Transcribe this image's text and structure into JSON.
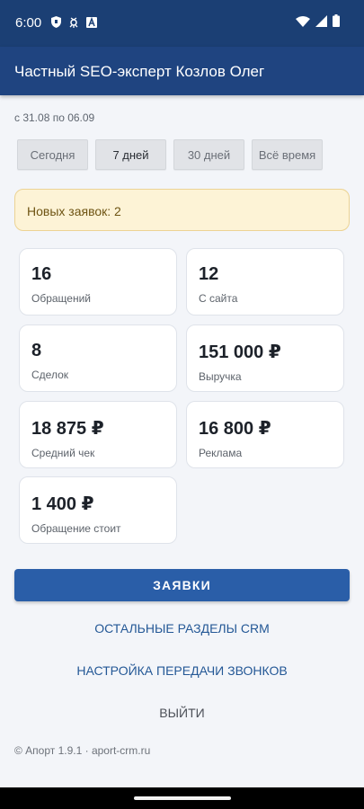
{
  "status_bar": {
    "time": "6:00",
    "icons_left": [
      "shield-icon",
      "bug-icon",
      "font-icon"
    ],
    "icons_right": [
      "wifi-icon",
      "signal-icon",
      "battery-icon"
    ]
  },
  "header": {
    "title": "Частный SEO-эксперт Козлов Олег"
  },
  "period": "с 31.08 по 06.09",
  "filters": [
    {
      "label": "Сегодня",
      "active": false
    },
    {
      "label": "7 дней",
      "active": true
    },
    {
      "label": "30 дней",
      "active": false
    },
    {
      "label": "Всё время",
      "active": false
    }
  ],
  "notice": "Новых заявок: 2",
  "stats": [
    {
      "value": "16",
      "label": "Обращений"
    },
    {
      "value": "12",
      "label": "С сайта"
    },
    {
      "value": "8",
      "label": "Сделок"
    },
    {
      "value": "151 000 ₽",
      "label": "Выручка"
    },
    {
      "value": "18 875 ₽",
      "label": "Средний чек"
    },
    {
      "value": "16 800 ₽",
      "label": "Реклама"
    },
    {
      "value": "1 400 ₽",
      "label": "Обращение стоит"
    }
  ],
  "actions": {
    "requests": "ЗАЯВКИ",
    "other_sections": "ОСТАЛЬНЫЕ РАЗДЕЛЫ CRM",
    "call_settings": "НАСТРОЙКА ПЕРЕДАЧИ ЗВОНКОВ",
    "logout": "ВЫЙТИ"
  },
  "footer": "© Апорт 1.9.1 · aport-crm.ru",
  "colors": {
    "status_bar": "#1b3f74",
    "app_bar": "#1f4480",
    "primary": "#2a5ea8",
    "link": "#245896",
    "notice_bg": "#fdf3d6"
  }
}
